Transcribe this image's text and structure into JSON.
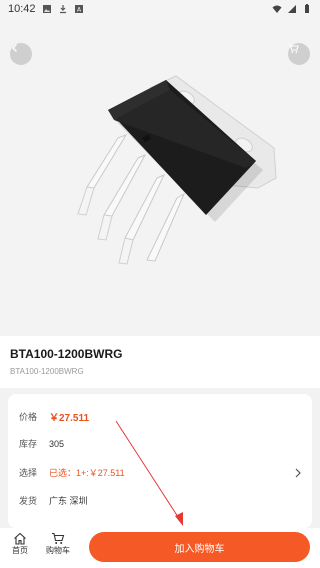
{
  "status_bar": {
    "time": "10:42",
    "icons_left": [
      "image-icon",
      "download-icon",
      "a-box-icon"
    ],
    "icons_right": [
      "wifi-icon",
      "signal-icon",
      "battery-icon"
    ]
  },
  "hero": {
    "product_image": "triac-component-photo",
    "back_icon": "chevron-left-icon",
    "cart_icon": "cart-icon"
  },
  "product": {
    "title": "BTA100-1200BWRG",
    "subtitle": "BTA100-1200BWRG"
  },
  "info": {
    "price_label": "价格",
    "price_value": "￥27.511",
    "stock_label": "库存",
    "stock_value": "305",
    "select_label": "选择",
    "select_value": "已选：1+:￥27.511",
    "ship_label": "发货",
    "ship_value": "广东 深圳"
  },
  "bottom": {
    "home_label": "首页",
    "cart_label": "购物车",
    "add_to_cart": "加入购物车"
  },
  "colors": {
    "accent": "#f55a26",
    "price": "#e8531f",
    "annotation": "#e53935"
  }
}
